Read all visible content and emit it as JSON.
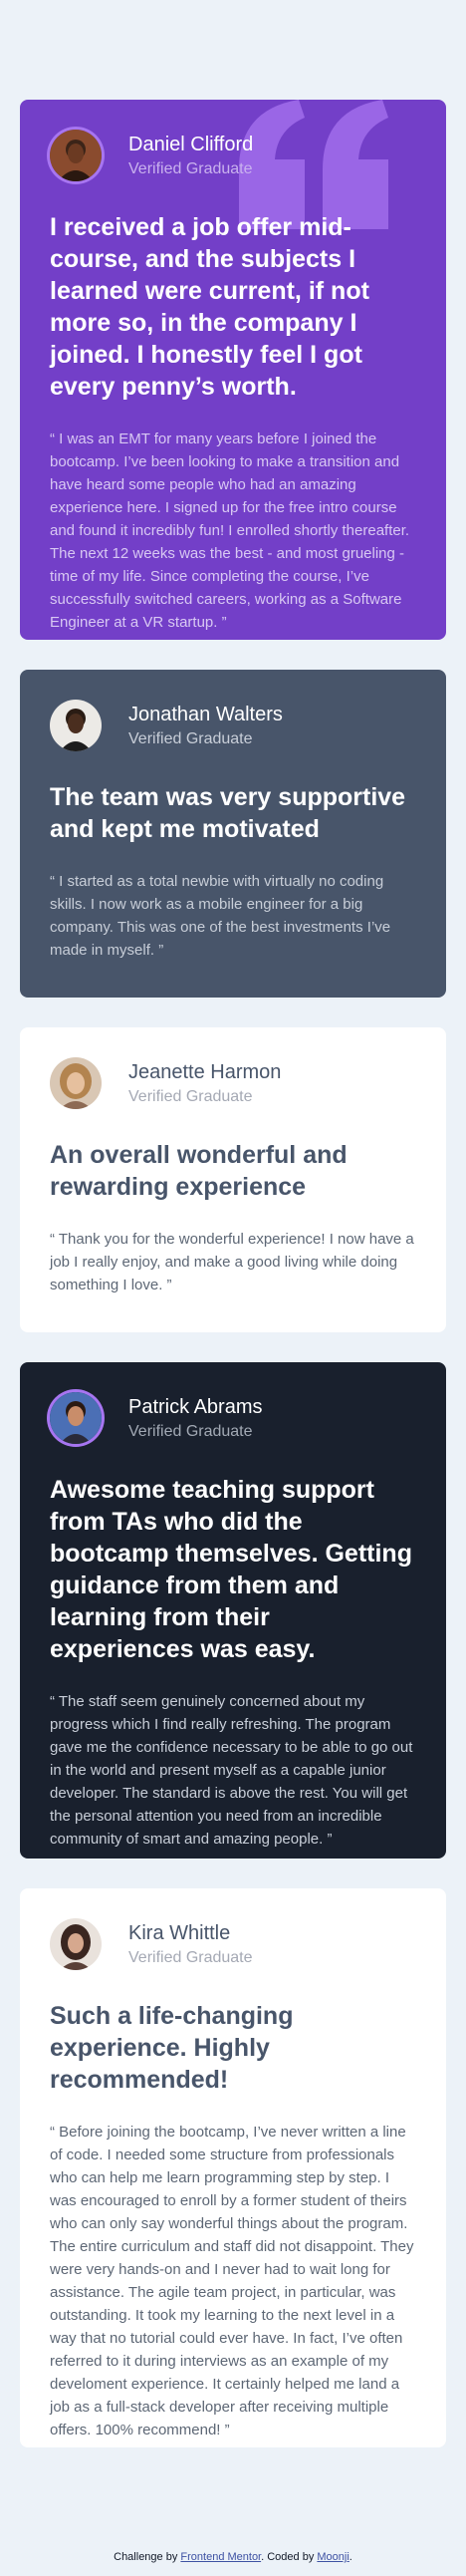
{
  "colors": {
    "page_bg": "#ecf2f8",
    "purple": "#733fc8",
    "grey_blue": "#48556a",
    "white": "#ffffff",
    "dark": "#19202d",
    "quote_mark": "#9a66e6"
  },
  "testimonials": [
    {
      "name": "Daniel Clifford",
      "role": "Verified Graduate",
      "headline": "I received a job offer mid-course, and the subjects I learned were current, if not more so, in the company I joined. I honestly feel I got every penny’s worth.",
      "body": "“ I was an EMT for many years before I joined the bootcamp. I’ve been looking to make a transition and have heard some people who had an amazing experience here. I signed up for the free intro course and found it incredibly fun! I enrolled shortly thereafter. The next 12 weeks was the best - and most grueling - time of my life. Since completing the course, I’ve successfully switched careers, working as a Software Engineer at a VR startup. ”",
      "avatar_icon": "avatar-daniel"
    },
    {
      "name": "Jonathan Walters",
      "role": "Verified Graduate",
      "headline": "The team was very supportive and kept me motivated",
      "body": "“ I started as a total newbie with virtually no coding skills. I now work as a mobile engineer for a big company. This was one of the best investments I’ve made in myself. ”",
      "avatar_icon": "avatar-jonathan"
    },
    {
      "name": "Jeanette Harmon",
      "role": "Verified Graduate",
      "headline": "An overall wonderful and rewarding experience",
      "body": "“ Thank you for the wonderful experience! I now have a job I really enjoy, and make a good living while doing something I love. ”",
      "avatar_icon": "avatar-jeanette"
    },
    {
      "name": "Patrick Abrams",
      "role": "Verified Graduate",
      "headline": "Awesome teaching support from TAs who did the bootcamp themselves. Getting guidance from them and learning from their experiences was easy.",
      "body": "“ The staff seem genuinely concerned about my progress which I find really refreshing. The program gave me the confidence necessary to be able to go out in the world and present myself as a capable junior developer. The standard is above the rest. You will get the personal attention you need from an incredible community of smart and amazing people. ”",
      "avatar_icon": "avatar-patrick"
    },
    {
      "name": "Kira Whittle",
      "role": "Verified Graduate",
      "headline": "Such a life-changing experience. Highly recommended!",
      "body": "“ Before joining the bootcamp, I’ve never written a line of code. I needed some structure from professionals who can help me learn programming step by step. I was encouraged to enroll by a former student of theirs who can only say wonderful things about the program. The entire curriculum and staff did not disappoint. They were very hands-on and I never had to wait long for assistance. The agile team project, in particular, was outstanding. It took my learning to the next level in a way that no tutorial could ever have. In fact, I’ve often referred to it during interviews as an example of my develoment experience. It certainly helped me land a job as a full-stack developer after receiving multiple offers. 100% recommend! ”",
      "avatar_icon": "avatar-kira"
    }
  ],
  "footer": {
    "prefix": "Challenge by ",
    "link1": "Frontend Mentor",
    "middle": ". Coded by ",
    "link2": "Moonji",
    "suffix": "."
  }
}
